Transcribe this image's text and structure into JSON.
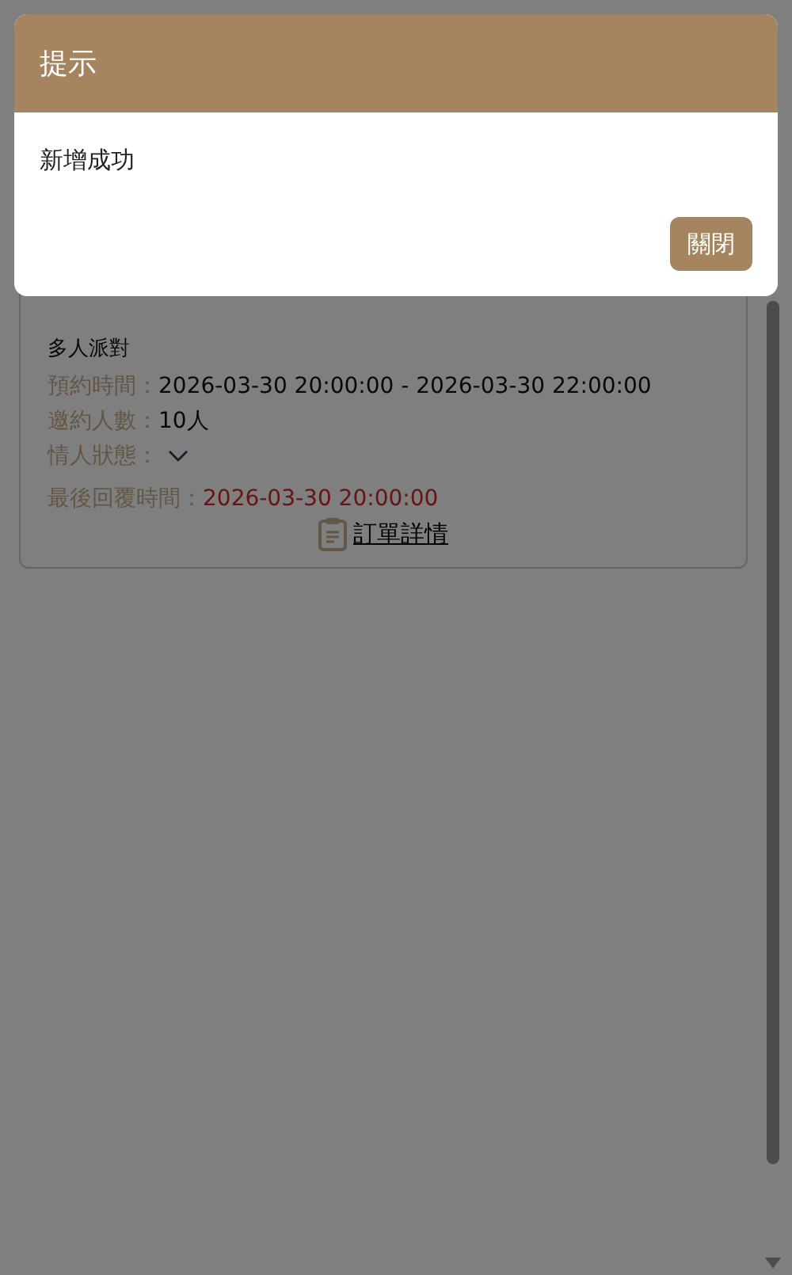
{
  "modal": {
    "title": "提示",
    "message": "新增成功",
    "close_button": "關閉"
  },
  "order": {
    "title": "多人派對",
    "fields": [
      {
        "kind": "text",
        "label": "預約時間：",
        "value": "2026-03-30 20:00:00 - 2026-03-30 22:00:00"
      },
      {
        "kind": "text",
        "label": "邀約人數：",
        "value": "10人"
      },
      {
        "kind": "dropdown",
        "label": "情人狀態："
      }
    ],
    "last_reply": {
      "label": "最後回覆時間：",
      "value": "2026-03-30 20:00:00"
    },
    "details_link": "訂單詳情"
  }
}
